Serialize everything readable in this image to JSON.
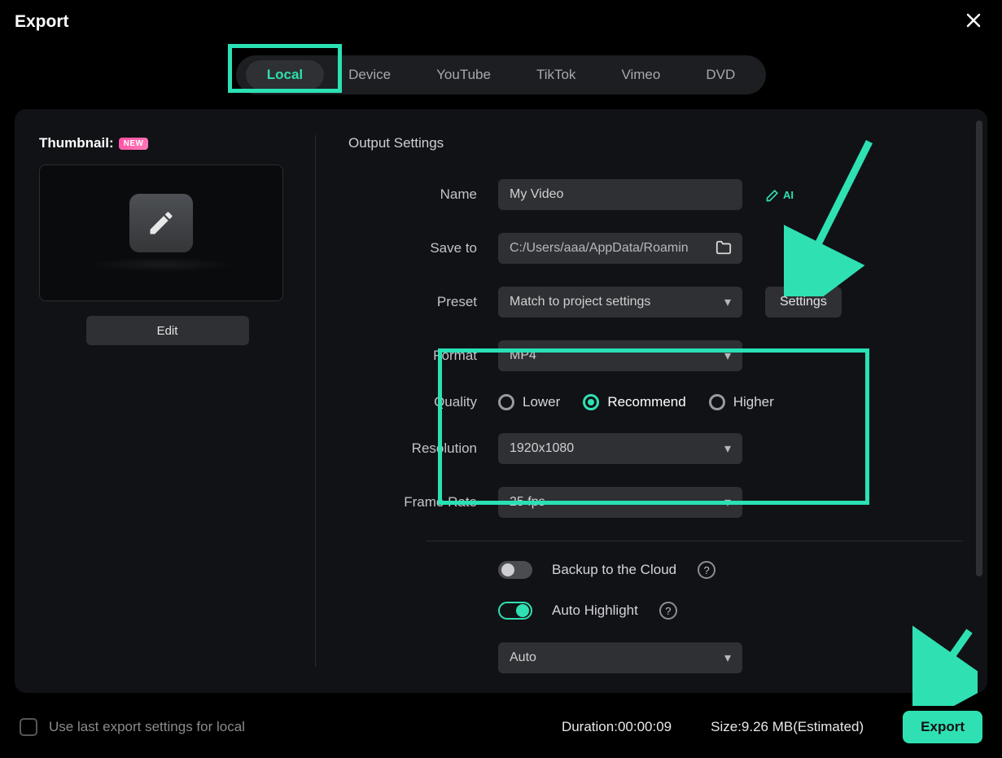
{
  "title": "Export",
  "tabs": [
    "Local",
    "Device",
    "YouTube",
    "TikTok",
    "Vimeo",
    "DVD"
  ],
  "active_tab": "Local",
  "thumbnail": {
    "label": "Thumbnail:",
    "badge": "NEW",
    "edit_label": "Edit"
  },
  "output": {
    "section_title": "Output Settings",
    "labels": {
      "name": "Name",
      "save_to": "Save to",
      "preset": "Preset",
      "format": "Format",
      "quality": "Quality",
      "resolution": "Resolution",
      "frame_rate": "Frame Rate"
    },
    "name_value": "My Video",
    "ai_label": "AI",
    "save_to_value": "C:/Users/aaa/AppData/Roamin",
    "preset_value": "Match to project settings",
    "settings_btn": "Settings",
    "format_value": "MP4",
    "quality_options": [
      "Lower",
      "Recommend",
      "Higher"
    ],
    "quality_selected": "Recommend",
    "resolution_value": "1920x1080",
    "frame_rate_value": "25 fps",
    "backup_label": "Backup to the Cloud",
    "backup_on": false,
    "auto_highlight_label": "Auto Highlight",
    "auto_highlight_on": true,
    "auto_highlight_mode": "Auto"
  },
  "footer": {
    "use_last_label": "Use last export settings for local",
    "duration_label": "Duration:",
    "duration_value": "00:00:09",
    "size_label": "Size:",
    "size_value": "9.26 MB(Estimated)",
    "export_label": "Export"
  },
  "colors": {
    "accent": "#2fe0b2"
  }
}
